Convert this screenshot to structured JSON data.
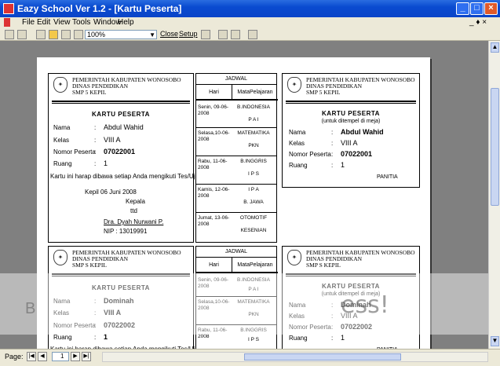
{
  "window": {
    "title": "Eazy School Ver 1.2 - [Kartu Peserta]",
    "minimize_glyph": "_",
    "maximize_glyph": "□",
    "close_glyph": "×"
  },
  "menu": {
    "items": [
      "File",
      "Edit",
      "View",
      "Tools",
      "Window",
      "Help"
    ],
    "mdi_controls": "_ ♦ ×"
  },
  "toolbar": {
    "zoom_value": "100%",
    "close_label": "Close",
    "setup_label": "Setup"
  },
  "status": {
    "pages_label": "Page:",
    "page_value": "1"
  },
  "school": {
    "line1": "PEMERINTAH KABUPATEN WONOSOBO",
    "line2": "DINAS PENDIDIKAN",
    "line3_a": "SMP 5 KEPIL",
    "line3_b": "SMP S KEPIL",
    "line3_c": "SMP 5 KEPIL"
  },
  "card": {
    "title": "KARTU PESERTA",
    "subtitle": "(untuk ditempel di meja)",
    "labels": {
      "name": "Nama",
      "class": "Kelas",
      "number": "Nomor Peserta",
      "room": "Ruang"
    },
    "colon": ":",
    "note": "Kartu ini harap dibawa setiap Anda mengikuti Tes/Ujian",
    "place_date": "Kepil        06 Juni 2008",
    "role": "Kepala",
    "ttd": "ttd",
    "head_name": "Dra. Dyah Nurwani P.",
    "nip": "NIP : 13019991",
    "panitia": "PANITIA"
  },
  "students": [
    {
      "name": "Abdul Wahid",
      "class": "VIII A",
      "number": "07022001",
      "room": "1"
    },
    {
      "name": "Dominah",
      "class": "VIII A",
      "number": "07022002",
      "room": "1"
    }
  ],
  "schedule": {
    "title": "JADWAL",
    "col_day": "Hari",
    "col_subject": "MataPelajaran",
    "rows": [
      {
        "day": "Senin, 09-06-2008",
        "s1": "B.INDONESIA",
        "s2": "P A I"
      },
      {
        "day": "Selasa,10-06-2008",
        "s1": "MATEMATIKA",
        "s2": "PKN"
      },
      {
        "day": "Rabu, 11-06-2008",
        "s1": "B.INGGRIS",
        "s2": "I P S"
      },
      {
        "day": "Kamis, 12-06-2008",
        "s1": "I P A",
        "s2": "B. JAWA"
      },
      {
        "day": "Jumat, 13-06-2008",
        "s1": "OTOMOTIF",
        "s2": "KESENIAN"
      }
    ]
  },
  "watermark": {
    "text": "ess!",
    "tail": "B"
  }
}
